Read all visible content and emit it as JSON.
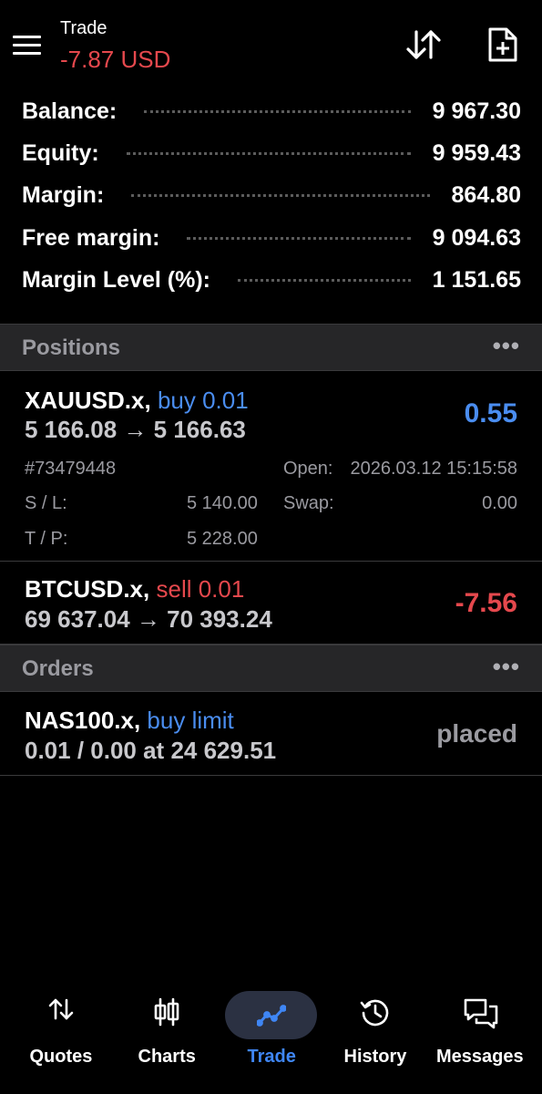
{
  "header": {
    "title": "Trade",
    "profit_loss": "-7.87 USD",
    "icons": [
      "menu-icon",
      "sort-arrows-icon",
      "new-document-icon"
    ]
  },
  "summary": [
    {
      "label": "Balance:",
      "value": "9 967.30"
    },
    {
      "label": "Equity:",
      "value": "9 959.43"
    },
    {
      "label": "Margin:",
      "value": "864.80"
    },
    {
      "label": "Free margin:",
      "value": "9 094.63"
    },
    {
      "label": "Margin Level (%):",
      "value": "1 151.65"
    }
  ],
  "positions": {
    "title": "Positions",
    "more": "•••",
    "items": [
      {
        "symbol": "XAUUSD.x,",
        "side": "buy 0.01",
        "prices": "5 166.08 → 5 166.63",
        "profit": "0.55",
        "ticket": "#73479448",
        "open_label": "Open:",
        "open_value": "2026.03.12 15:15:58",
        "sl_label": "S / L:",
        "sl_value": "5 140.00",
        "swap_label": "Swap:",
        "swap_value": "0.00",
        "tp_label": "T / P:",
        "tp_value": "5 228.00"
      },
      {
        "symbol": "BTCUSD.x,",
        "side": "sell 0.01",
        "prices": "69 637.04 → 70 393.24",
        "profit": "-7.56"
      }
    ]
  },
  "orders": {
    "title": "Orders",
    "more": "•••",
    "items": [
      {
        "symbol": "NAS100.x,",
        "side": "buy limit",
        "details": "0.01 / 0.00 at 24 629.51",
        "status": "placed"
      }
    ]
  },
  "nav": [
    {
      "label": "Quotes",
      "icon": "quotes-arrows-icon"
    },
    {
      "label": "Charts",
      "icon": "candlestick-chart-icon"
    },
    {
      "label": "Trade",
      "icon": "trade-line-icon",
      "active": true
    },
    {
      "label": "History",
      "icon": "history-clock-icon"
    },
    {
      "label": "Messages",
      "icon": "messages-chat-icon"
    }
  ],
  "colors": {
    "background": "#000000",
    "profit_positive": "#4a8df0",
    "profit_negative": "#e5484d",
    "section_header": "#262628",
    "active_nav": "#3f86f5"
  }
}
